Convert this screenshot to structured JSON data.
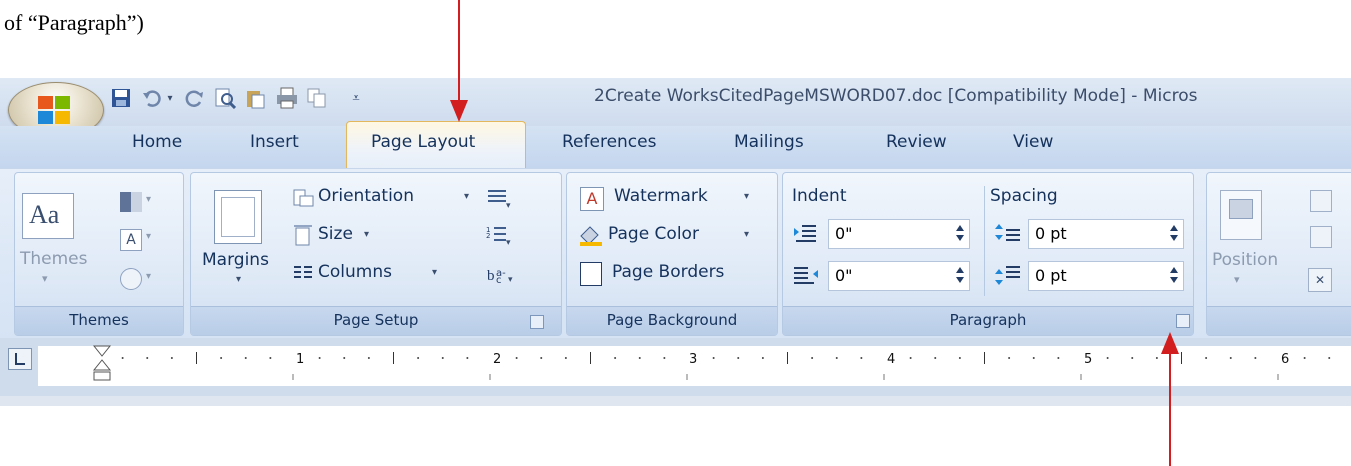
{
  "caption": {
    "text": "of “Paragraph”)"
  },
  "window": {
    "title": "2Create WorksCitedPageMSWORD07.doc [Compatibility Mode] - Micros"
  },
  "tabs": [
    {
      "label": "Home",
      "active": false
    },
    {
      "label": "Insert",
      "active": false
    },
    {
      "label": "Page Layout",
      "active": true
    },
    {
      "label": "References",
      "active": false
    },
    {
      "label": "Mailings",
      "active": false
    },
    {
      "label": "Review",
      "active": false
    },
    {
      "label": "View",
      "active": false
    }
  ],
  "groups": {
    "themes": {
      "label": "Themes",
      "button": "Themes"
    },
    "page_setup": {
      "label": "Page Setup",
      "margins": "Margins",
      "orientation": "Orientation",
      "size": "Size",
      "columns": "Columns"
    },
    "page_background": {
      "label": "Page Background",
      "watermark": "Watermark",
      "page_color": "Page Color",
      "page_borders": "Page Borders"
    },
    "paragraph": {
      "label": "Paragraph",
      "indent_label": "Indent",
      "spacing_label": "Spacing",
      "indent_left": "0\"",
      "indent_right": "0\"",
      "spacing_before": "0 pt",
      "spacing_after": "0 pt"
    },
    "arrange": {
      "position": "Position"
    }
  },
  "ruler": {
    "numbers": [
      "1",
      "2",
      "3",
      "4",
      "5",
      "6"
    ]
  },
  "colors": {
    "accent_arrow": "#d21e1e",
    "tab_text": "#15325c",
    "ribbon_bg": "#dde8f6"
  }
}
